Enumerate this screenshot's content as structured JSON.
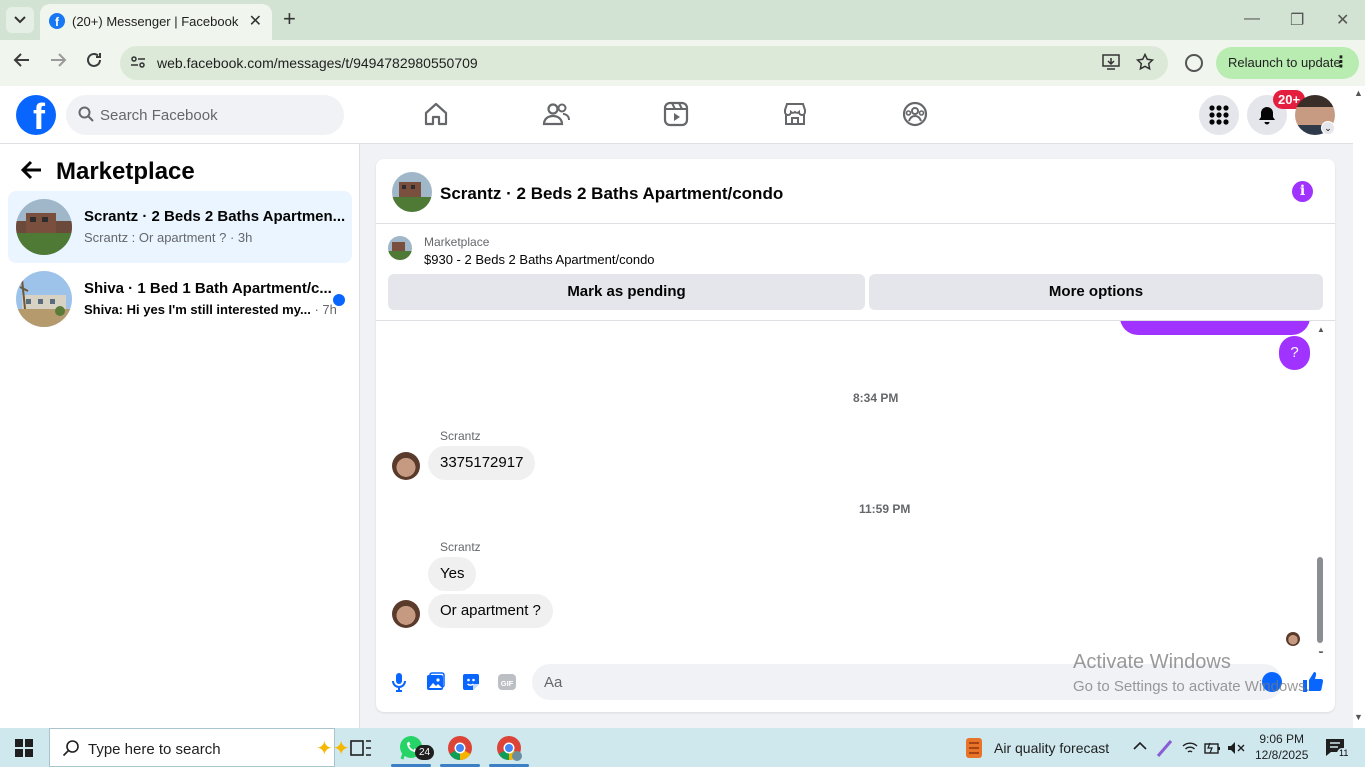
{
  "browser": {
    "tab_title": "(20+) Messenger | Facebook",
    "tab_close": "✕",
    "new_tab": "+",
    "url": "web.facebook.com/messages/t/9494782980550709",
    "relaunch_label": "Relaunch to update",
    "window_minimize": "—",
    "window_restore": "❐",
    "window_close": "✕"
  },
  "header": {
    "logo_letter": "f",
    "search_placeholder": "Search Facebook",
    "nav_icons": [
      "home-icon",
      "friends-icon",
      "video-icon",
      "marketplace-icon",
      "groups-icon"
    ],
    "notification_badge": "20+",
    "colors": {
      "facebook_blue": "#0866ff",
      "badge_red": "#e41e3f"
    }
  },
  "sidebar": {
    "title": "Marketplace",
    "conversations": [
      {
        "name": "Scrantz · 2 Beds 2 Baths Apartmen...",
        "snippet": "Scrantz : Or apartment ?",
        "time": " · 3h",
        "active": true,
        "unread": false
      },
      {
        "name": "Shiva · 1 Bed 1 Bath Apartment/c...",
        "snippet": "Shiva: Hi yes I'm still interested my...",
        "time": " · 7h",
        "active": false,
        "unread": true
      }
    ]
  },
  "chat": {
    "title": "Scrantz · 2 Beds 2 Baths Apartment/condo",
    "info_icon": "i",
    "marketplace_label": "Marketplace",
    "listing": "$930 - 2 Beds 2 Baths Apartment/condo",
    "mark_pending_label": "Mark as pending",
    "more_options_label": "More options",
    "accent_color": "#a033ff",
    "messages": {
      "outgoing_question": "?",
      "timestamp_1": "8:34 PM",
      "sender_1": "Scrantz",
      "msg_phone": "3375172917",
      "timestamp_2": "11:59 PM",
      "sender_2": "Scrantz",
      "msg_yes": "Yes",
      "msg_apartment": "Or apartment ?"
    },
    "composer_placeholder": "Aa"
  },
  "watermark": {
    "line1": "Activate Windows",
    "line2": "Go to Settings to activate Windows."
  },
  "taskbar": {
    "search_placeholder": "Type here to search",
    "whatsapp_badge": "24",
    "weather_label": "Air quality forecast",
    "time": "9:06 PM",
    "date": "12/8/2025",
    "notifications_count": "11"
  }
}
